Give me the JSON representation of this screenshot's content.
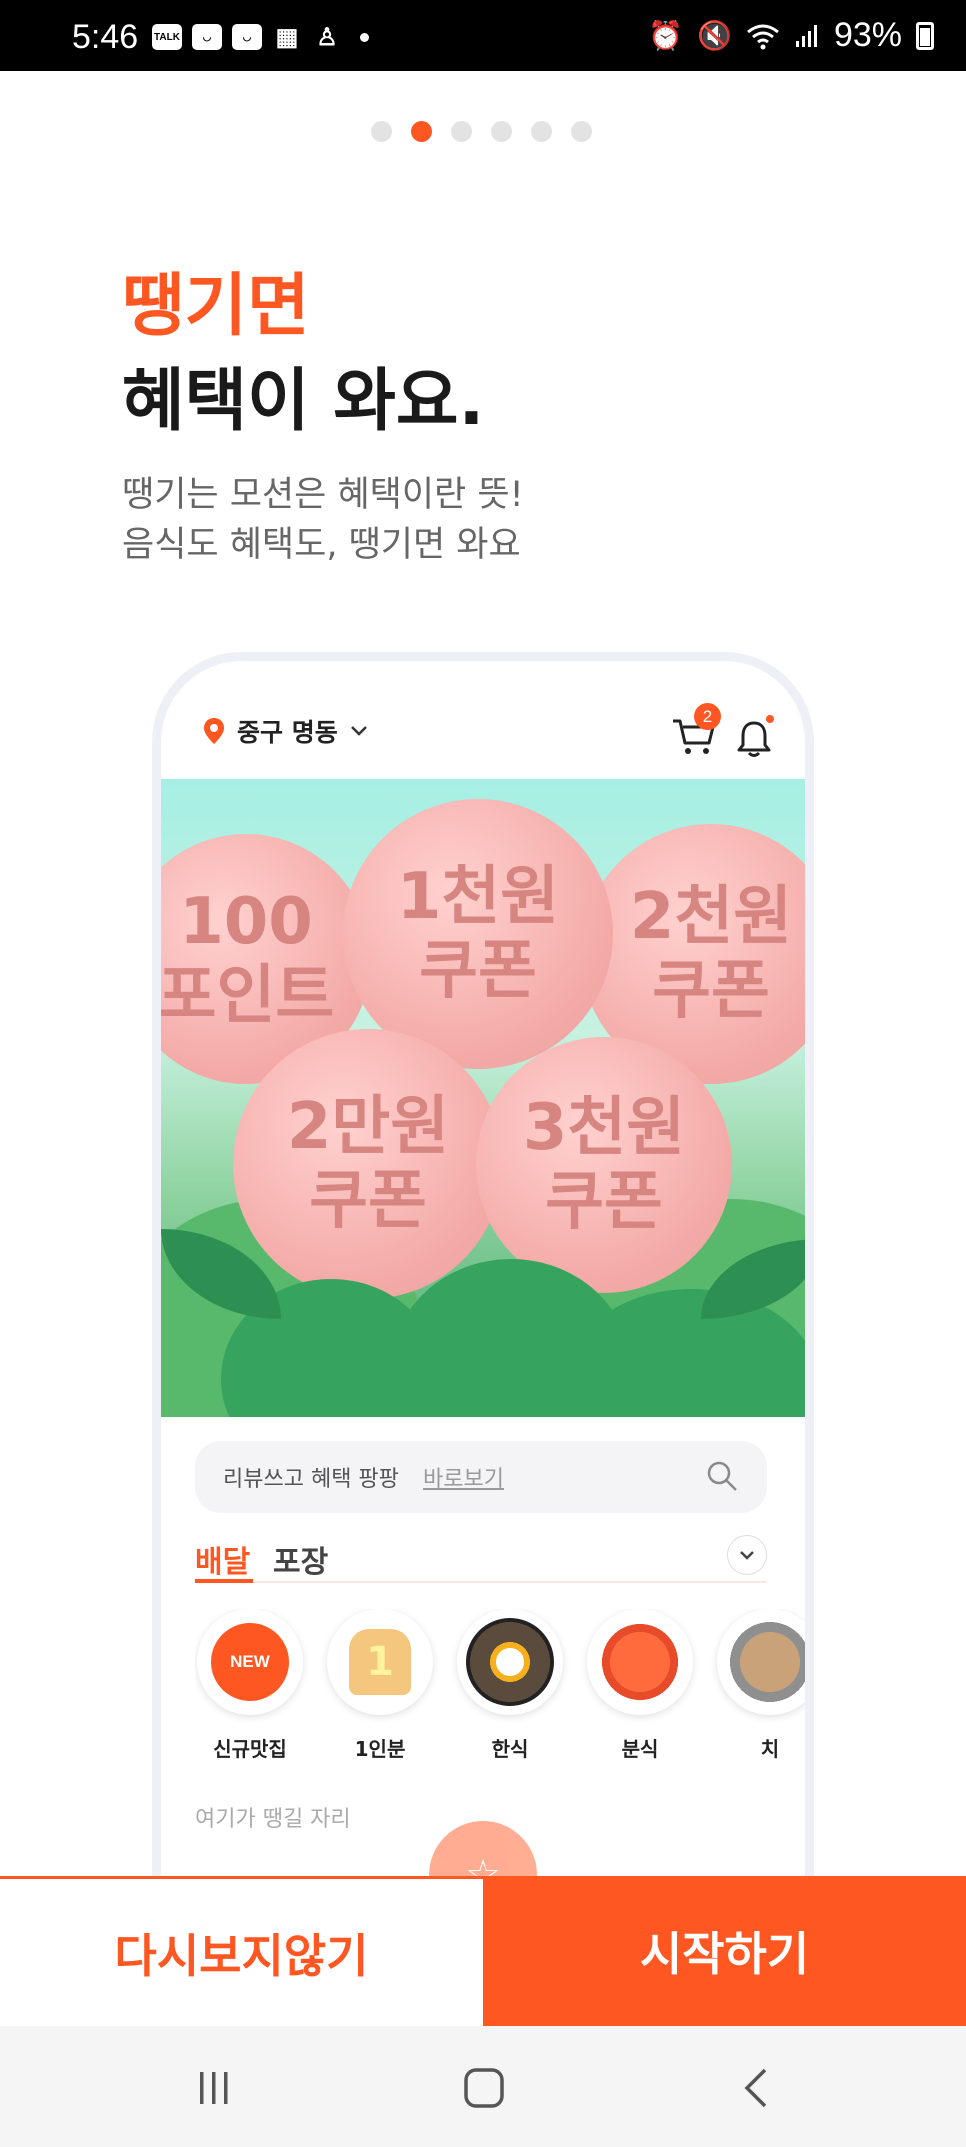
{
  "status_bar": {
    "time": "5:46",
    "notification_icons": [
      "talk-icon",
      "mail-icon",
      "mail-icon",
      "news-icon",
      "app-icon"
    ],
    "talk_label": "TALK",
    "battery": "93%"
  },
  "pager": {
    "total": 6,
    "active_index": 1
  },
  "headline": {
    "accent": "땡기면",
    "main": "혜택이 와요."
  },
  "description": {
    "line1": "땡기는 모션은 혜택이란 뜻!",
    "line2": "음식도 혜택도, 땡기면 와요"
  },
  "preview": {
    "location": "중구 명동",
    "cart_count": "2",
    "banner_balloons": [
      {
        "line1": "100",
        "line2": "포인트"
      },
      {
        "line1": "1천원",
        "line2": "쿠폰"
      },
      {
        "line1": "2천원",
        "line2": "쿠폰"
      },
      {
        "line1": "2만원",
        "line2": "쿠폰"
      },
      {
        "line1": "3천원",
        "line2": "쿠폰"
      }
    ],
    "search": {
      "text": "리뷰쓰고 혜택 팡팡",
      "link": "바로보기"
    },
    "tabs": {
      "delivery": "배달",
      "takeout": "포장"
    },
    "categories": [
      {
        "label": "신규맛집",
        "badge": "NEW"
      },
      {
        "label": "1인분",
        "badge": "1"
      },
      {
        "label": "한식"
      },
      {
        "label": "분식"
      },
      {
        "label": "치"
      }
    ],
    "section_hint": "여기가 땡길 자리"
  },
  "buttons": {
    "dismiss": "다시보지않기",
    "start": "시작하기"
  },
  "colors": {
    "accent": "#ff5722",
    "text_dark": "#1a1a1a",
    "text_muted": "#666666"
  }
}
